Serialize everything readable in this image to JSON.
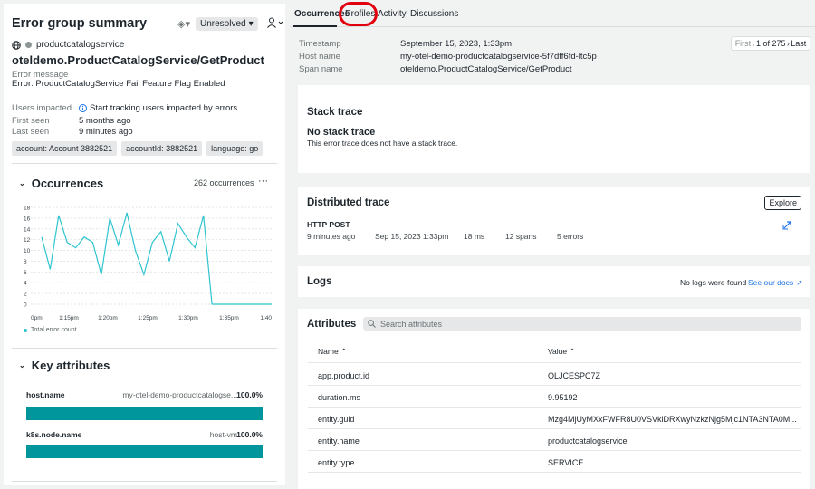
{
  "left": {
    "title": "Error group summary",
    "status_dropdown": "Unresolved",
    "service_name": "productcatalogservice",
    "error_title": "otel​demo.ProductCatalogService/GetProduct",
    "error_message_label": "Error message",
    "error_message": "Error: ProductCatalogService Fail Feature Flag Enabled",
    "users_impacted_label": "Users impacted",
    "users_impacted_value": "Start tracking users impacted by errors",
    "first_seen_label": "First seen",
    "first_seen_value": "5 months ago",
    "last_seen_label": "Last seen",
    "last_seen_value": "9 minutes ago",
    "tags": [
      "account: Account 3882521",
      "accountId: 3882521",
      "language: go"
    ],
    "occurrences_title": "Occurrences",
    "occurrences_count": "262 occurrences",
    "legend_label": "Total error count",
    "key_attributes_title": "Key attributes",
    "key_attrs": [
      {
        "name": "host.name",
        "value": "my-otel-demo-productcatalogse...",
        "pct": "100.0%",
        "fraction": 1.0
      },
      {
        "name": "k8s.node.name",
        "value": "host-vm",
        "pct": "100.0%",
        "fraction": 1.0
      }
    ]
  },
  "chart_data": {
    "type": "line",
    "y_ticks": [
      "18",
      "16",
      "14",
      "12",
      "10",
      "8",
      "6",
      "4",
      "2",
      "0"
    ],
    "x_ticks": [
      "0pm",
      "1:15pm",
      "1:20pm",
      "1:25pm",
      "1:30pm",
      "1:35pm",
      "1:40"
    ],
    "ylim": [
      0,
      18
    ],
    "series": [
      {
        "name": "Total error count",
        "color": "#2ec4cf",
        "values": [
          12.5,
          6.5,
          16.5,
          11.5,
          10.5,
          12.5,
          11.5,
          5.5,
          16,
          11,
          17,
          10,
          5.5,
          11.5,
          13.5,
          8,
          15,
          12.5,
          10.5,
          16.5,
          0,
          0,
          0,
          0,
          0,
          0,
          0,
          0
        ]
      }
    ],
    "grid": true
  },
  "tabs": [
    "Occurrences",
    "Profiles",
    "Activity",
    "Discussions"
  ],
  "meta": {
    "timestamp_label": "Timestamp",
    "timestamp": "September 15, 2023, 1:33pm",
    "host_label": "Host name",
    "host": "my-otel-demo-productcatalogservice-5f7dff6fd-ltc5p",
    "span_label": "Span name",
    "span": "oteldemo.ProductCatalogService/GetProduct"
  },
  "pager": {
    "first": "First",
    "pos": "1 of 275",
    "last": "Last"
  },
  "stack": {
    "title": "Stack trace",
    "empty_title": "No stack trace",
    "empty_text": "This error trace does not have a stack trace."
  },
  "dtrace": {
    "title": "Distributed trace",
    "explore": "Explore",
    "method": "HTTP POST",
    "ago": "9 minutes ago",
    "time": "Sep 15, 2023 1:33pm",
    "duration": "18 ms",
    "spans": "12 spans",
    "errors": "5 errors"
  },
  "logs": {
    "title": "Logs",
    "empty": "No logs were found",
    "docs": "See our docs"
  },
  "attributes": {
    "title": "Attributes",
    "search_placeholder": "Search attributes",
    "col_name": "Name",
    "col_value": "Value",
    "rows": [
      {
        "name": "app.product.id",
        "value": "OLJCESPC7Z"
      },
      {
        "name": "duration.ms",
        "value": "9.95192"
      },
      {
        "name": "entity.guid",
        "value": "Mzg4MjUyMXxFWFR8U0VSVklDRXwyNzkzNjg5Mjc1NTA3NTA0M..."
      },
      {
        "name": "entity.name",
        "value": "productcatalogservice"
      },
      {
        "name": "entity.type",
        "value": "SERVICE"
      }
    ]
  },
  "colors": {
    "accent": "#00969c",
    "line": "#2ec4cf",
    "highlight": "#e2000f"
  }
}
